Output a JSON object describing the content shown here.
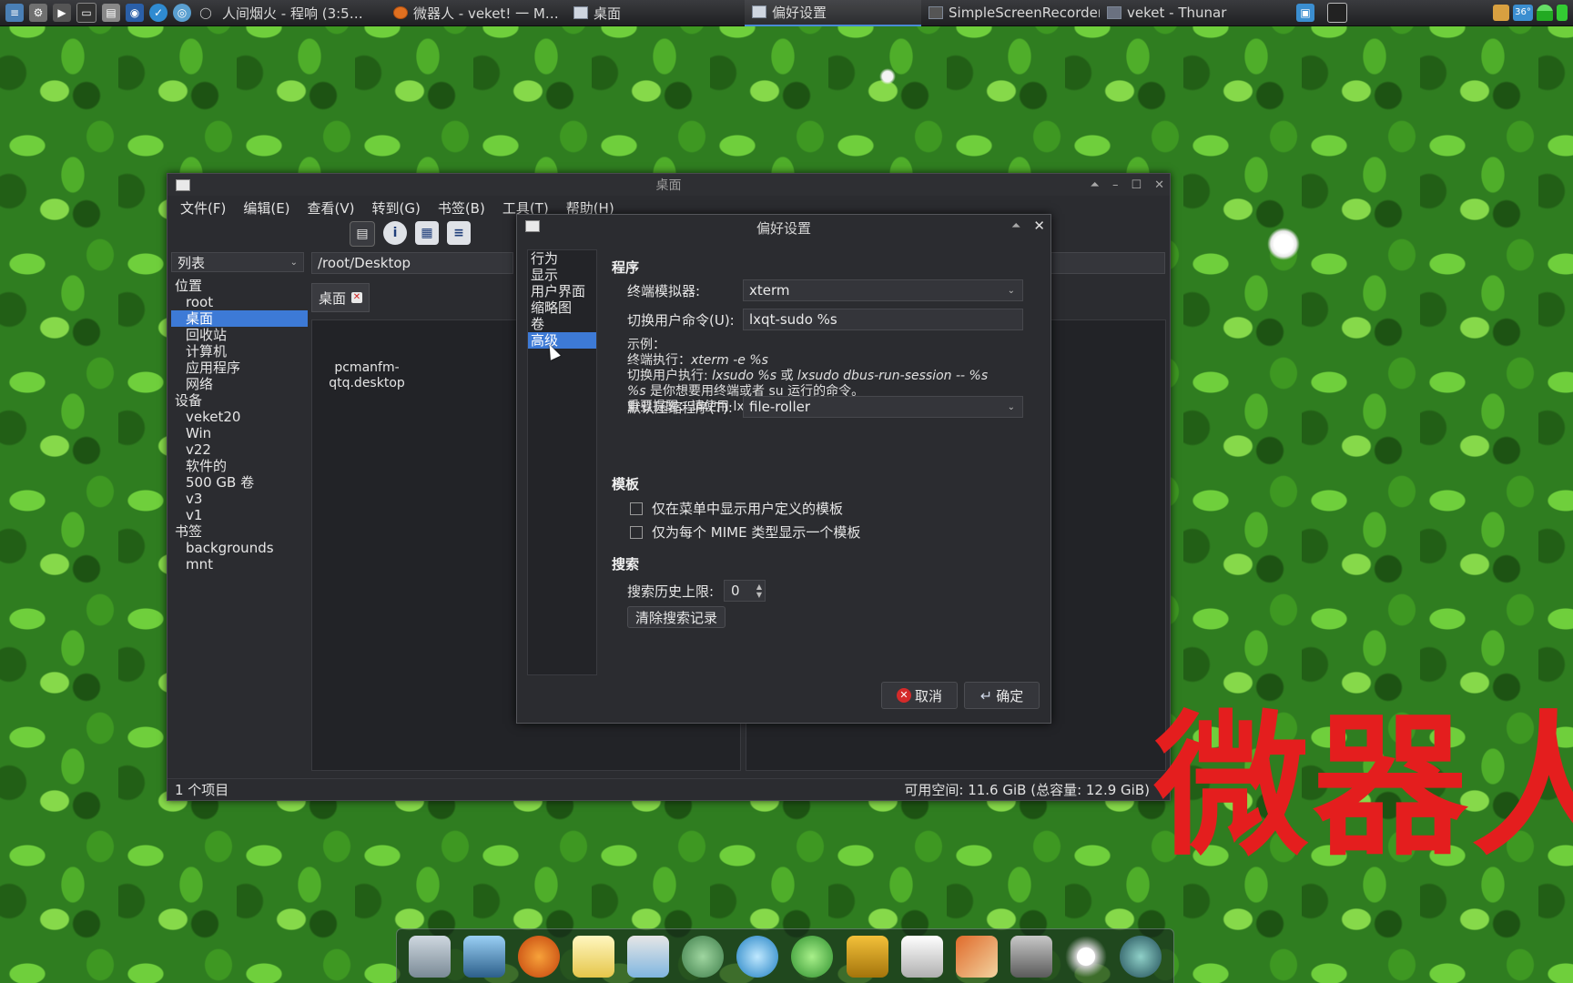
{
  "taskbar": {
    "tasks": [
      "人间烟火 - 程响 (3:5…",
      "微器人 - veket! 一 M…",
      "桌面",
      "偏好设置",
      "SimpleScreenRecorder",
      "veket - Thunar"
    ],
    "tray_temp": "36°"
  },
  "fm": {
    "title": "桌面",
    "menu": [
      "文件(F)",
      "编辑(E)",
      "查看(V)",
      "转到(G)",
      "书签(B)",
      "工具(T)",
      "帮助(H)"
    ],
    "view_select": "列表",
    "path": "/root/Desktop",
    "tab": "桌面",
    "sidebar": {
      "places_label": "位置",
      "places": [
        "root",
        "桌面",
        "回收站",
        "计算机",
        "应用程序",
        "网络"
      ],
      "devices_label": "设备",
      "devices": [
        "veket20",
        "Win",
        "v22",
        "软件的",
        "500 GB 卷",
        "v3",
        "v1"
      ],
      "bookmarks_label": "书签",
      "bookmarks": [
        "backgrounds",
        "mnt"
      ]
    },
    "file": "pcmanfm-qtq.desktop",
    "file_line1": "pcmanfm-",
    "file_line2": "qtq.desktop",
    "status_left": "1 个项目",
    "status_right": "可用空间: 11.6 GiB (总容量: 12.9 GiB)"
  },
  "dialog": {
    "title": "偏好设置",
    "nav": [
      "行为",
      "显示",
      "用户界面",
      "缩略图",
      "卷",
      "高级"
    ],
    "programs": {
      "heading": "程序",
      "terminal_label": "终端模拟器:",
      "terminal_value": "xterm",
      "su_label": "切换用户命令(U):",
      "su_value": "lxqt-sudo %s",
      "hint_example": "示例：",
      "hint_term_prefix": "终端执行：",
      "hint_term_cmd": "xterm -e %s",
      "hint_su_prefix": "切换用户执行: ",
      "hint_su_cmd1": "lxsudo %s",
      "hint_or": " 或 ",
      "hint_su_cmd2": "lxsudo dbus-run-session -- %s",
      "hint_pct": "%s",
      "hint_pct_text": " 是你想要用终端或者 su 运行的命令。",
      "hint_warning": "重要提醒：请使用 lxsudo，仅使用 sudo 会破坏设置文件的权限。",
      "archiver_label": "默认压缩程序(T):",
      "archiver_value": "file-roller"
    },
    "templates": {
      "heading": "模板",
      "opt1": "仅在菜单中显示用户定义的模板",
      "opt2": "仅为每个 MIME 类型显示一个模板"
    },
    "search": {
      "heading": "搜索",
      "history_label": "搜索历史上限:",
      "history_value": "0",
      "clear_button": "清除搜索记录"
    },
    "cancel": "取消",
    "ok": "确定"
  },
  "watermark": "微器人",
  "colors": {
    "accent": "#3d7ad6",
    "watermark": "#e41e1e",
    "window_bg": "#2b2c30"
  }
}
